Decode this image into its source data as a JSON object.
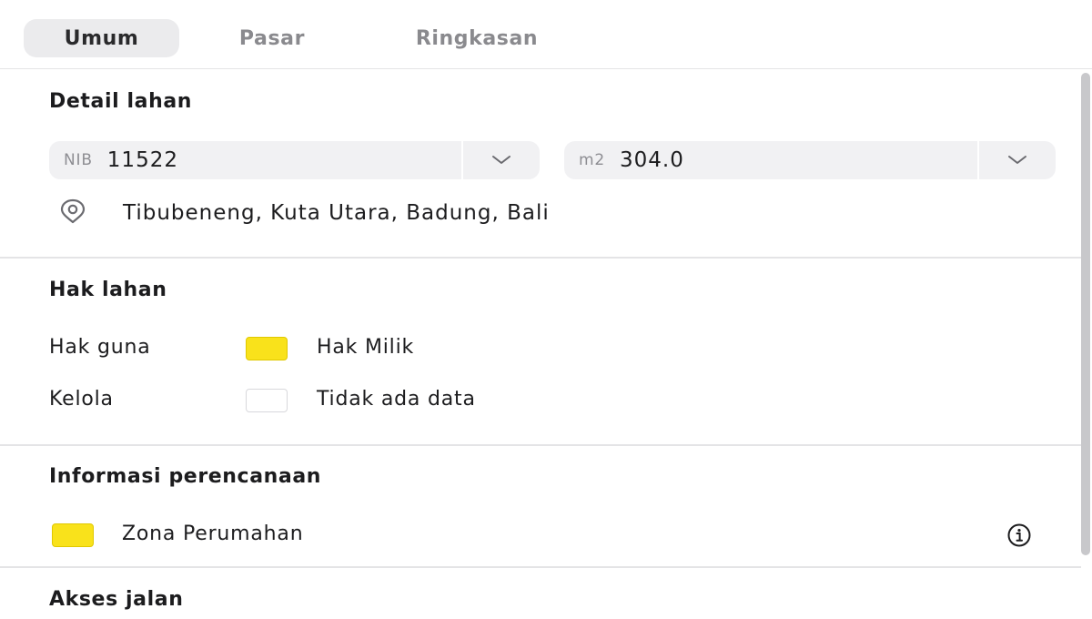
{
  "tabs": [
    {
      "label": "Umum",
      "active": true
    },
    {
      "label": "Pasar",
      "active": false
    },
    {
      "label": "Ringkasan",
      "active": false
    }
  ],
  "land_detail": {
    "title": "Detail lahan",
    "nib": {
      "prefix": "NIB",
      "value": "11522"
    },
    "area": {
      "prefix": "m2",
      "value": "304.0"
    },
    "location": "Tibubeneng, Kuta Utara, Badung, Bali"
  },
  "land_rights": {
    "title": "Hak lahan",
    "rows": [
      {
        "label": "Hak guna",
        "value": "Hak Milik",
        "color": "#f9e21b"
      },
      {
        "label": "Kelola",
        "value": "Tidak ada data",
        "color": "#ffffff"
      }
    ]
  },
  "planning": {
    "title": "Informasi perencanaan",
    "zone": {
      "value": "Zona Perumahan",
      "color": "#f9e21b"
    },
    "info_icon": "info-icon"
  },
  "road_access": {
    "title": "Akses jalan"
  },
  "colors": {
    "accent_yellow": "#f9e21b",
    "tab_active_bg": "#ebebed",
    "field_bg": "#f1f1f3"
  }
}
